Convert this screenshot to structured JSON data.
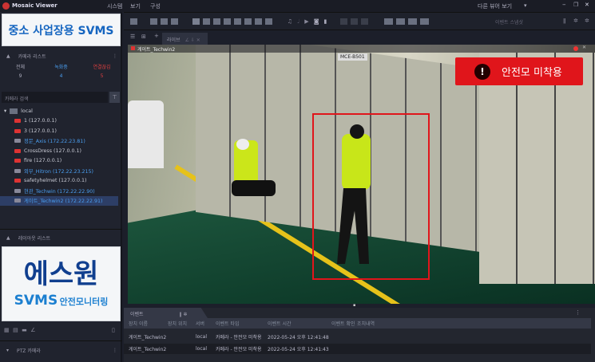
{
  "app": {
    "title": "Mosaic Viewer",
    "menu": [
      "시스템",
      "보기",
      "구성"
    ],
    "other_viewer": "다른 뷰어 보기",
    "window_controls": [
      "minimize",
      "maximize",
      "close"
    ]
  },
  "sidebar": {
    "banner_top": "중소 사업장용 SVMS",
    "camera_list": {
      "title": "카메라 리스트",
      "stats": [
        {
          "label": "전체",
          "value": "9"
        },
        {
          "label": "녹화중",
          "value": "4"
        },
        {
          "label": "연결끊김",
          "value": "5"
        }
      ],
      "search_placeholder": "카메라 검색",
      "root": "local",
      "items": [
        {
          "label": "1 (127.0.0.1)",
          "status": "disconnected"
        },
        {
          "label": "3 (127.0.0.1)",
          "status": "disconnected"
        },
        {
          "label": "정문_Axis (172.22.23.81)",
          "status": "recording"
        },
        {
          "label": "CrossDress (127.0.0.1)",
          "status": "disconnected"
        },
        {
          "label": "fire (127.0.0.1)",
          "status": "disconnected"
        },
        {
          "label": "외부_Hitron (172.22.23.215)",
          "status": "recording"
        },
        {
          "label": "safetyhelmet (127.0.0.1)",
          "status": "disconnected"
        },
        {
          "label": "현관_Techwin (172.22.22.90)",
          "status": "recording"
        },
        {
          "label": "게이트_Techwin2 (172.22.22.91)",
          "status": "recording",
          "selected": true
        }
      ]
    },
    "layout_list": {
      "title": "레이아웃 리스트"
    },
    "banner_bottom": {
      "line1": "에스원",
      "line2a": "SVMS",
      "line2b": "안전모니터링"
    },
    "ptz": {
      "title": "PTZ 카메라"
    }
  },
  "toolbar": {
    "event_search_placeholder": "이벤트 스냅샷"
  },
  "tabs": {
    "active": "라이브"
  },
  "video": {
    "camera_label": "게이트_Techwin2",
    "alert": "안전모 미착용",
    "panel_label": "MCE-B501"
  },
  "events": {
    "title": "이벤트",
    "columns": [
      "장치 이름",
      "장치 위치",
      "서버",
      "이벤트 타입",
      "이벤트 시간",
      "이벤트 확인",
      "조치내역"
    ],
    "rows": [
      [
        "게이트_Techwin2",
        "",
        "local",
        "카메라 - 안전모 미착용",
        "2022-05-24 오후 12:41:48",
        "",
        ""
      ],
      [
        "게이트_Techwin2",
        "",
        "local",
        "카메라 - 안전모 미착용",
        "2022-05-24 오후 12:41:43",
        "",
        ""
      ]
    ]
  },
  "colors": {
    "accent": "#3b8ee8",
    "alert": "#e0151b",
    "recording": "#4a9ef0",
    "disconnected": "#e04040"
  }
}
